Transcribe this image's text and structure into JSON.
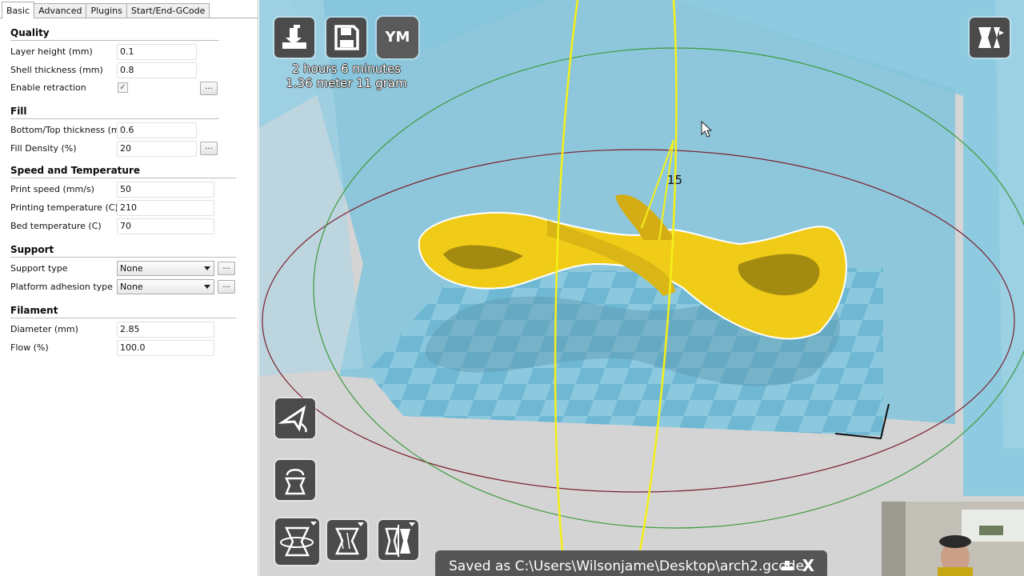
{
  "tabs": [
    "Basic",
    "Advanced",
    "Plugins",
    "Start/End-GCode"
  ],
  "active_tab": "Basic",
  "sections": {
    "quality": {
      "title": "Quality",
      "layer_height_label": "Layer height (mm)",
      "layer_height_value": "0.1",
      "shell_thickness_label": "Shell thickness (mm)",
      "shell_thickness_value": "0.8",
      "retraction_label": "Enable retraction",
      "retraction_checked": true,
      "retraction_check_glyph": "✓"
    },
    "fill": {
      "title": "Fill",
      "bottom_top_label": "Bottom/Top thickness (mm)",
      "bottom_top_value": "0.6",
      "density_label": "Fill Density (%)",
      "density_value": "20"
    },
    "speed": {
      "title": "Speed and Temperature",
      "print_speed_label": "Print speed (mm/s)",
      "print_speed_value": "50",
      "print_temp_label": "Printing temperature (C)",
      "print_temp_value": "210",
      "bed_temp_label": "Bed temperature (C)",
      "bed_temp_value": "70"
    },
    "support": {
      "title": "Support",
      "type_label": "Support type",
      "type_value": "None",
      "adhesion_label": "Platform adhesion type",
      "adhesion_value": "None"
    },
    "filament": {
      "title": "Filament",
      "diameter_label": "Diameter (mm)",
      "diameter_value": "2.85",
      "flow_label": "Flow (%)",
      "flow_value": "100.0"
    }
  },
  "more_button_label": "...",
  "viewport": {
    "print_time": "2 hours 6 minutes",
    "material": "1.36 meter 11 gram",
    "user_badge": "YM",
    "angle_readout": "15",
    "status_message": "Saved as C:\\Users\\Wilsonjame\\Desktop\\arch2.gcode",
    "close_label": "X"
  },
  "icons": {
    "load": "load-model-icon",
    "save": "save-icon",
    "view_mode": "view-mode-icon",
    "rotate": "rotate-icon",
    "scale": "scale-icon",
    "mirror": "mirror-icon",
    "rotate_tool": "rotate-tool-icon",
    "scale_tool": "scale-tool-icon",
    "mirror_tool": "mirror-tool-icon"
  },
  "colors": {
    "model": "#f2cf1a",
    "build_volume": "#7cc3db",
    "toolbar_button": "#4b4b4b",
    "status_bar": "#555555"
  }
}
